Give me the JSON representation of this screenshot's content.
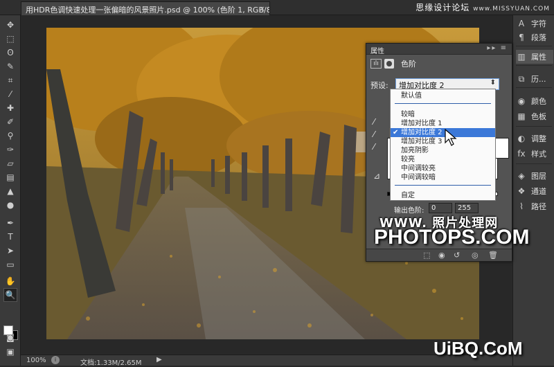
{
  "document_tab": {
    "title": "用HDR色调快速处理一张偏暗的风景照片.psd @ 100% (色阶 1, RGB/8) *",
    "close": "×"
  },
  "brand_top": "思缘设计论坛",
  "brand_top_url": "www.MISSYUAN.COM",
  "toolbar": {
    "tools": [
      "move-icon",
      "marquee-icon",
      "lasso-icon",
      "quick-select-icon",
      "crop-icon",
      "eyedropper-icon",
      "healing-icon",
      "brush-icon",
      "clone-stamp-icon",
      "history-brush-icon",
      "eraser-icon",
      "gradient-icon",
      "blur-icon",
      "dodge-icon",
      "pen-icon",
      "type-icon",
      "path-select-icon",
      "shape-icon",
      "hand-icon",
      "zoom-icon"
    ],
    "foreground_color": "#ffffff",
    "background_color": "#000000"
  },
  "dock": {
    "items": [
      {
        "icon": "character-icon",
        "label": "字符"
      },
      {
        "icon": "paragraph-icon",
        "label": "段落"
      },
      {
        "icon": "properties-icon",
        "label": "属性"
      },
      {
        "icon": "history-icon",
        "label": "历..."
      },
      {
        "icon": "color-icon",
        "label": "颜色"
      },
      {
        "icon": "swatches-icon",
        "label": "色板"
      },
      {
        "icon": "adjustments-icon",
        "label": "调整"
      },
      {
        "icon": "styles-icon",
        "label": "样式"
      },
      {
        "icon": "layers-icon",
        "label": "图层"
      },
      {
        "icon": "channels-icon",
        "label": "通道"
      },
      {
        "icon": "paths-icon",
        "label": "路径"
      }
    ]
  },
  "properties": {
    "tab_label": "属性",
    "panel_title": "色阶",
    "preset_label": "预设:",
    "preset_value": "增加对比度 2",
    "output_label": "输出色阶:",
    "output_low": "0",
    "output_high": "255"
  },
  "preset_menu": {
    "items": [
      {
        "label": "默认值",
        "selected": false
      },
      {
        "label": "较暗",
        "selected": false
      },
      {
        "label": "增加对比度 1",
        "selected": false
      },
      {
        "label": "增加对比度 2",
        "selected": true
      },
      {
        "label": "增加对比度 3",
        "selected": false
      },
      {
        "label": "加亮阴影",
        "selected": false
      },
      {
        "label": "较亮",
        "selected": false
      },
      {
        "label": "中间调较亮",
        "selected": false
      },
      {
        "label": "中间调较暗",
        "selected": false
      },
      {
        "label": "自定",
        "selected": false
      }
    ],
    "check": "✔"
  },
  "status_bar": {
    "zoom": "100%",
    "doc_info": "文档:1.33M/2.65M",
    "arrow": "▶"
  },
  "watermarks": {
    "line1": "WWW. 照片处理网",
    "line2": "PHOTOPS.COM",
    "bottom": "UiBQ.CoM"
  }
}
